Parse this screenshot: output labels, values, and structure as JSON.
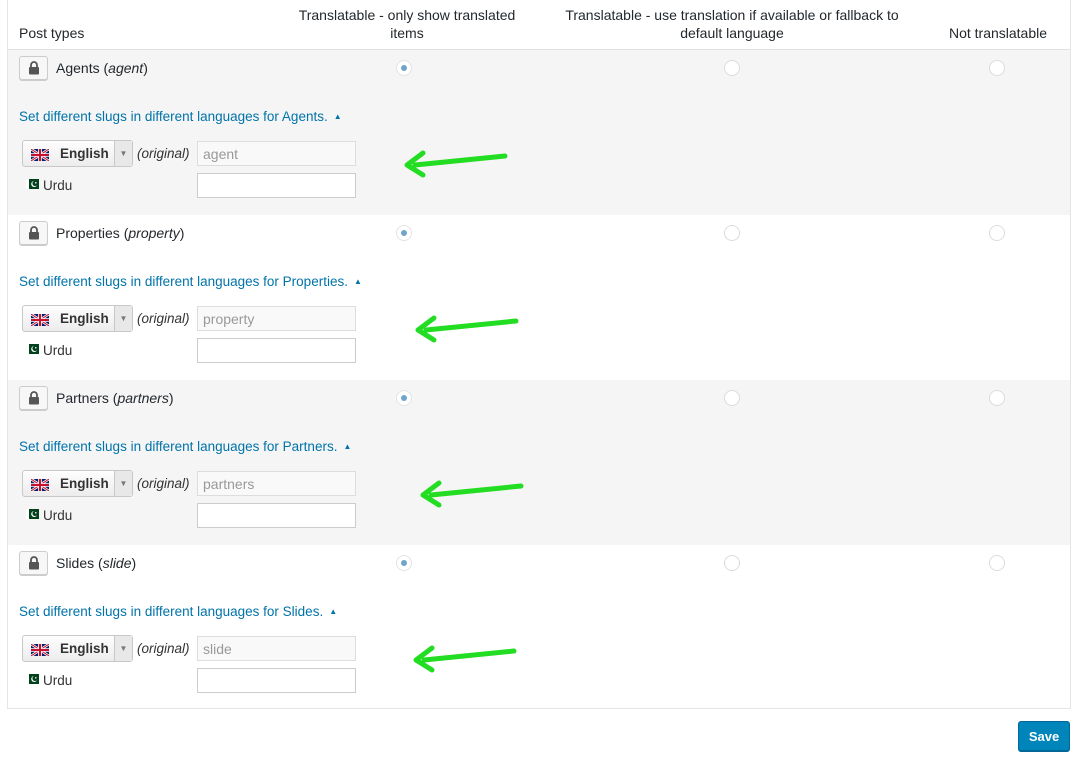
{
  "header": {
    "post_types": "Post types",
    "col_translatable_only": "Translatable - only show translated items",
    "col_translatable_fallback": "Translatable - use translation if available or fallback to default language",
    "col_not_translatable": "Not translatable"
  },
  "post_types": [
    {
      "name": "Agents",
      "slug": "agent",
      "selected_mode": "translatable_only",
      "slug_toggle": "Set different slugs in different languages for Agents.",
      "default_language": "English",
      "original_label": "(original)",
      "original_value": "agent",
      "secondary_language": "Urdu",
      "secondary_value": ""
    },
    {
      "name": "Properties",
      "slug": "property",
      "selected_mode": "translatable_only",
      "slug_toggle": "Set different slugs in different languages for Properties.",
      "default_language": "English",
      "original_label": "(original)",
      "original_value": "property",
      "secondary_language": "Urdu",
      "secondary_value": ""
    },
    {
      "name": "Partners",
      "slug": "partners",
      "selected_mode": "translatable_only",
      "slug_toggle": "Set different slugs in different languages for Partners.",
      "default_language": "English",
      "original_label": "(original)",
      "original_value": "partners",
      "secondary_language": "Urdu",
      "secondary_value": ""
    },
    {
      "name": "Slides",
      "slug": "slide",
      "selected_mode": "translatable_only",
      "slug_toggle": "Set different slugs in different languages for Slides.",
      "default_language": "English",
      "original_label": "(original)",
      "original_value": "slide",
      "secondary_language": "Urdu",
      "secondary_value": ""
    }
  ],
  "save_label": "Save",
  "colors": {
    "link": "#0073aa",
    "primary_button": "#0085ba",
    "annotation_arrow": "#22dd22",
    "row_alt_bg": "#f5f5f5"
  },
  "icons": {
    "lock": "lock-icon",
    "uk_flag": "uk-flag-icon",
    "pk_flag": "pakistan-flag-icon",
    "caret": "dropdown-caret-icon",
    "toggle": "triangle-up-icon",
    "arrow": "green-arrow-icon"
  }
}
